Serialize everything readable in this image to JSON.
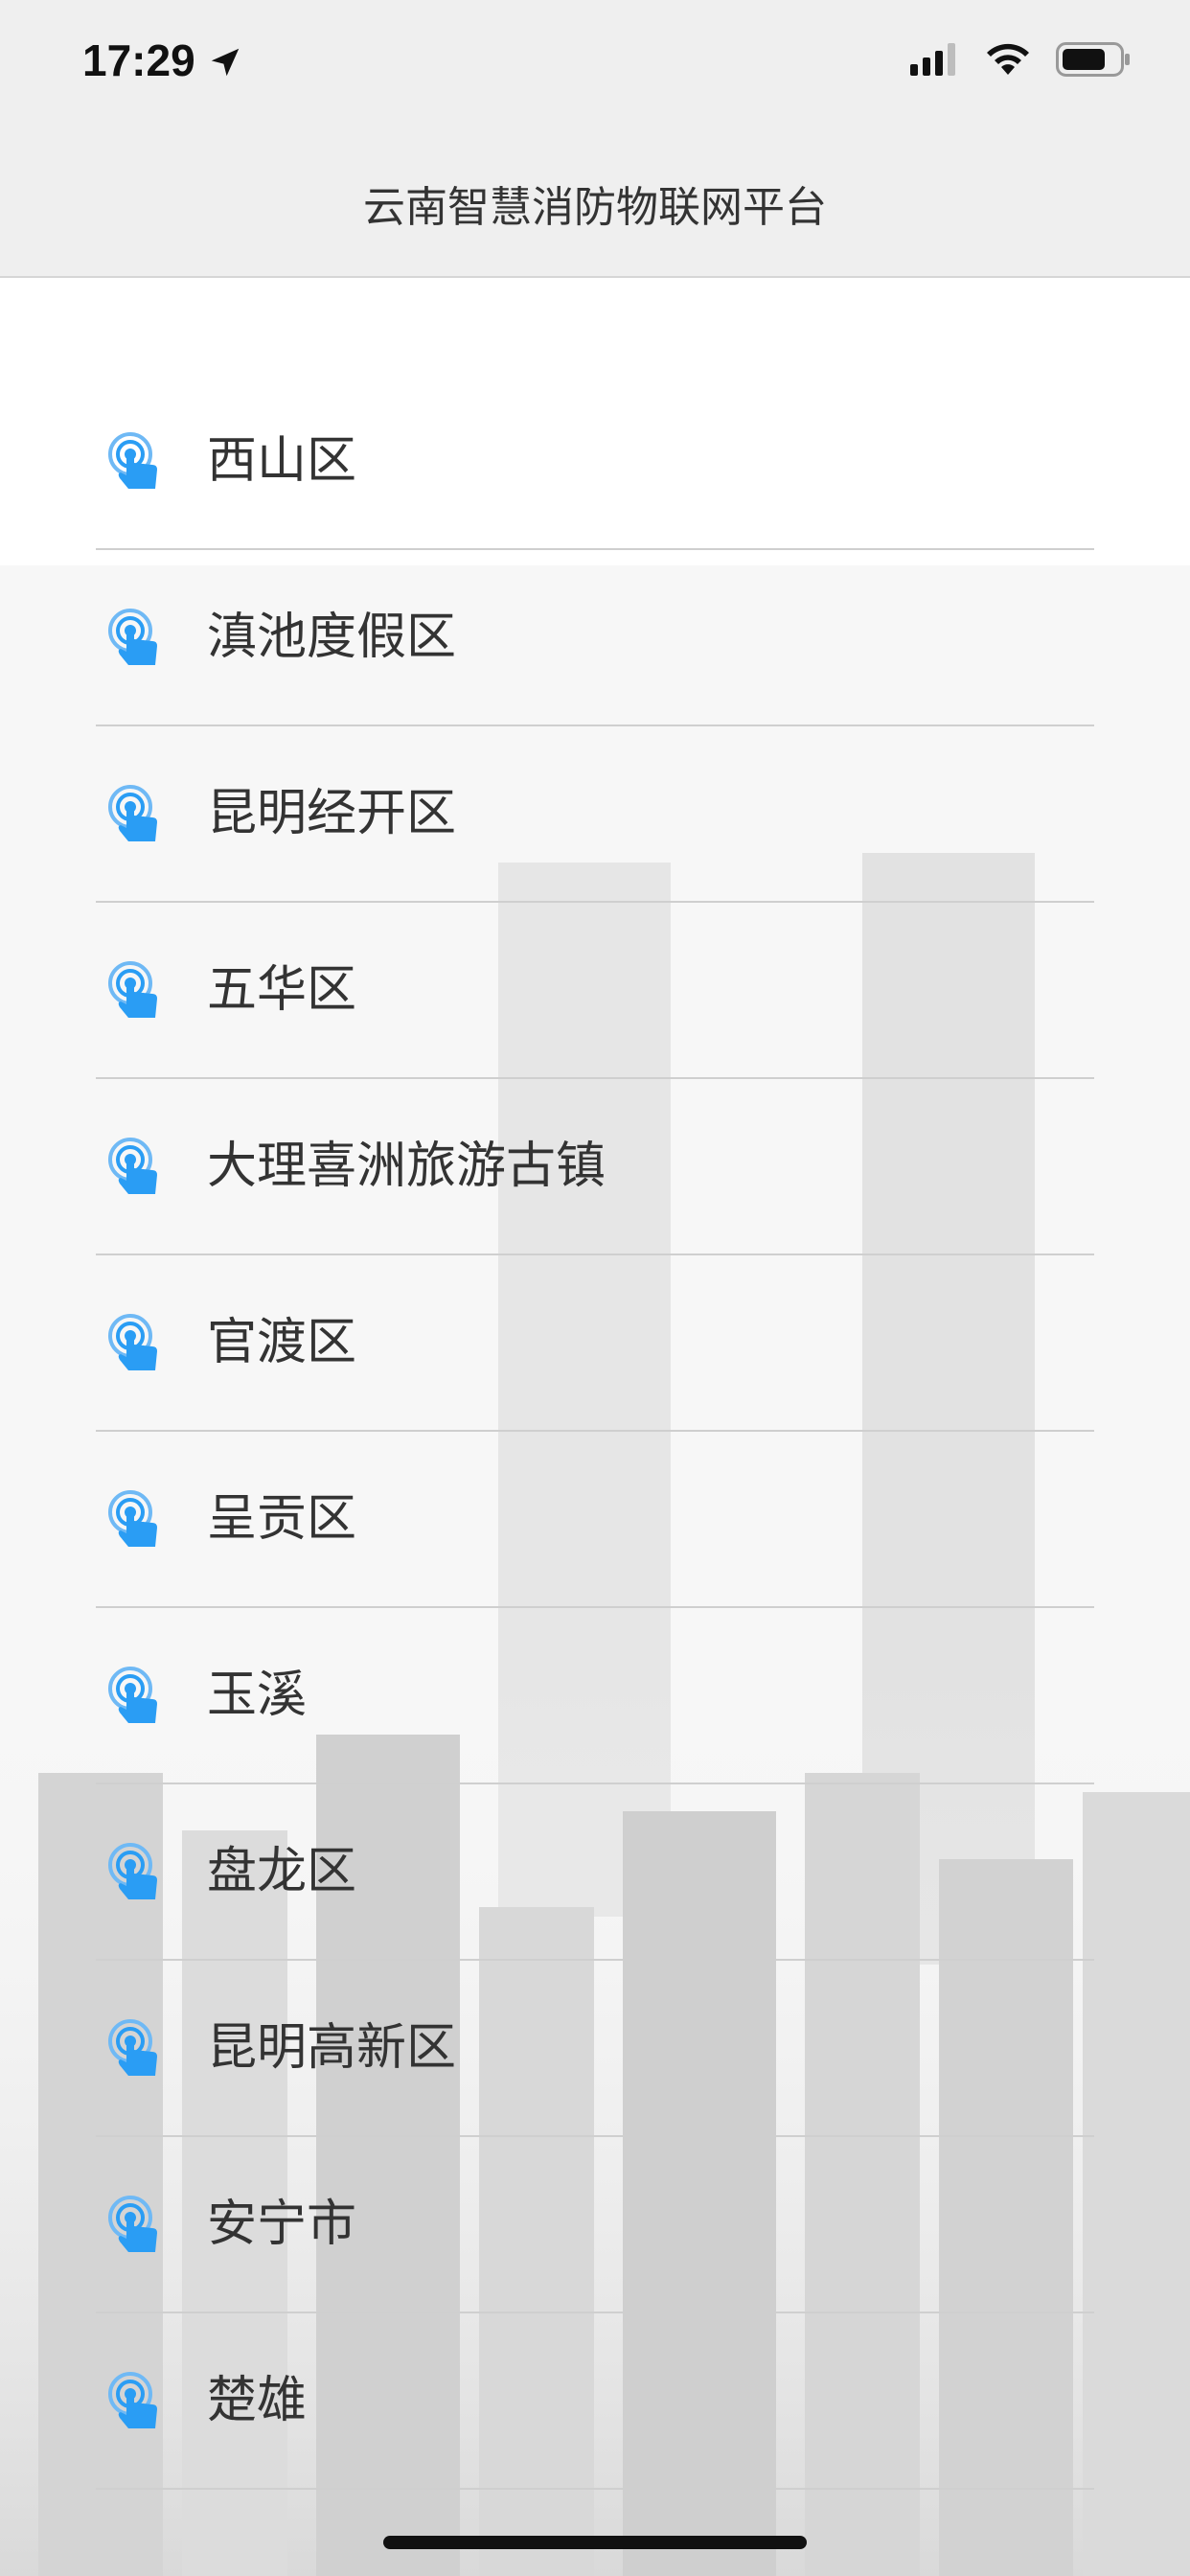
{
  "status_bar": {
    "time": "17:29",
    "icons": [
      "location-arrow-icon",
      "cellular-signal-icon",
      "wifi-icon",
      "battery-icon"
    ]
  },
  "header": {
    "title": "云南智慧消防物联网平台"
  },
  "list": {
    "icon": "location-tap-icon",
    "accent_color": "#2a9df4",
    "items": [
      {
        "label": "西山区"
      },
      {
        "label": "滇池度假区"
      },
      {
        "label": "昆明经开区"
      },
      {
        "label": "五华区"
      },
      {
        "label": "大理喜洲旅游古镇"
      },
      {
        "label": "官渡区"
      },
      {
        "label": "呈贡区"
      },
      {
        "label": "玉溪"
      },
      {
        "label": "盘龙区"
      },
      {
        "label": "昆明高新区"
      },
      {
        "label": "安宁市"
      },
      {
        "label": "楚雄"
      }
    ]
  }
}
